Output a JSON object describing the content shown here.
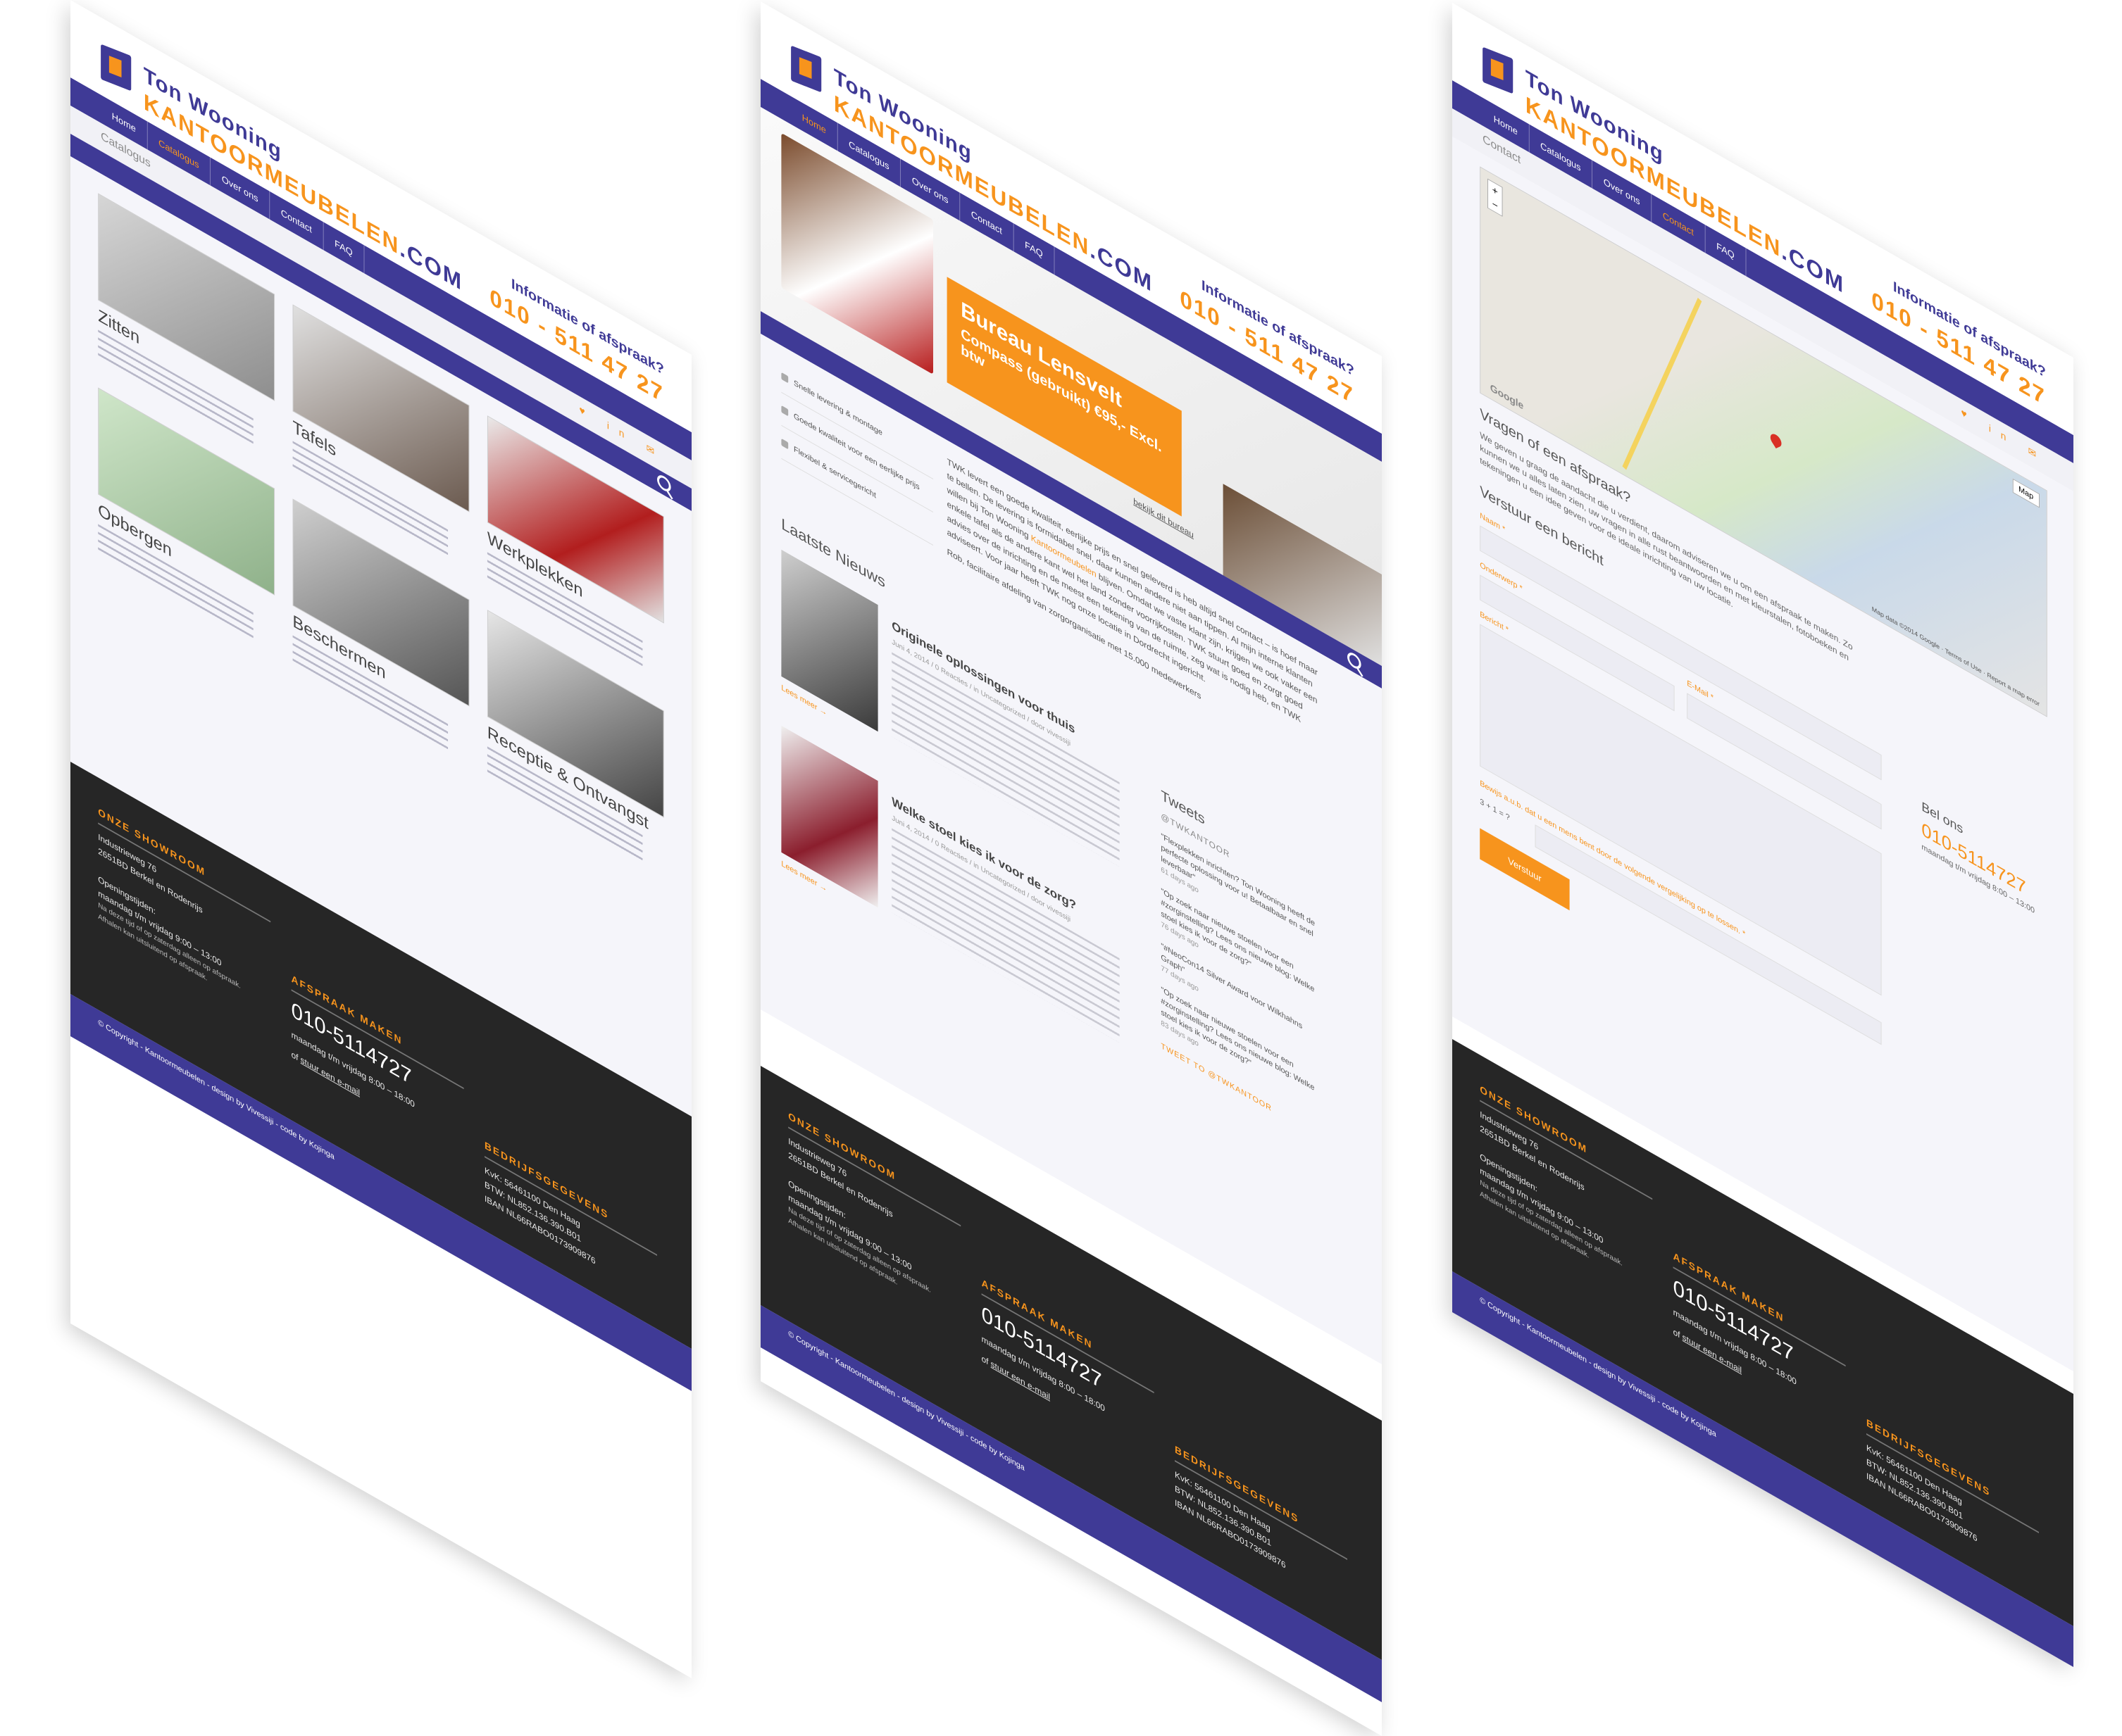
{
  "brand": {
    "name": "Ton Wooning",
    "domain_main": "KANTOORMEUBELEN",
    "domain_ext": ".COM",
    "info_label": "Informatie of afspraak?",
    "info_phone": "010 - 511 47 27"
  },
  "nav": [
    "Home",
    "Catalogus",
    "Over ons",
    "Contact",
    "FAQ"
  ],
  "social": "♥ in ✉",
  "pages": {
    "catalog": {
      "breadcrumb": "Catalogus",
      "categories": [
        "Zitten",
        "Tafels",
        "Werkplekken",
        "Opbergen",
        "Beschermen",
        "Receptie & Ontvangst"
      ]
    },
    "home": {
      "hero_title": "Bureau Lensvelt",
      "hero_sub": "Compass (gebruikt) €95,- Excl. btw",
      "hero_link": "bekijk dit bureau",
      "usps": [
        "Snelle levering & montage",
        "Goede kwaliteit voor een eerlijke prijs",
        "Flexibel & servicegericht"
      ],
      "intro_a": "TWK levert een goede kwaliteit, eerlijke prijs en snel geleverd is heb altijd snel contact – is hoef maar te bellen. De levering is formidabel snel, daar kunnen andere niet aan tippen. Al mijn interne klanten willen bij Ton Wooning ",
      "intro_hl": "Kantoormeubelen",
      "intro_b": " blijven. Omdat we vaste klant zijn, krijgen we ook vaker een enkele tafel als de andere kant wel het land zonder voorrijkosten. TWK stuurt goed en zorgt goed advies over de inrichting en de meest een tekening van de ruimte, zeg wat is nodig heb, en TWK adviseert. Voor jaar heeft TWK nog onze locatie in Dordrecht ingericht.",
      "intro_sig": "Rob, facilitaire afdeling van zorgorganisatie met 15.000 medewerkers",
      "news_heading": "Laatste Nieuws",
      "news": [
        {
          "title": "Originele oplossingen voor thuis",
          "meta": "Juni 4, 2014 / 0 Reacties / in Uncategorized / door vivessiji",
          "more": "Lees meer →"
        },
        {
          "title": "Welke stoel kies ik voor de zorg?",
          "meta": "Juni 4, 2014 / 0 Reacties / in Uncategorized / door vivessiji",
          "more": "Lees meer →"
        }
      ],
      "tweets_heading": "Tweets",
      "tweets_handle": "@TWKANTOOR",
      "tweets": [
        {
          "text": "\"Flexplekken inrichten? Ton Wooning heeft de perfecte oplossing voor u! Betaalbaar en snel leverbaar\"",
          "date": "61 days ago"
        },
        {
          "text": "\"Op zoek naar nieuwe stoelen voor een #zorginstelling? Lees ons nieuwe blog: Welke stoel kies ik voor de zorg?\"",
          "date": "76 days ago"
        },
        {
          "text": "\"#NeoCon14 Silver Award voor Wilkhahns Graph\"",
          "date": "77 days ago"
        },
        {
          "text": "\"Op zoek naar nieuwe stoelen voor een #zorginstelling? Lees ons nieuwe blog: Welke stoel kies ik voor de zorg?\"",
          "date": "83 days ago"
        }
      ],
      "tweet_to": "TWEET TO @TWKANTOOR"
    },
    "contact": {
      "breadcrumb": "Contact",
      "map_type": "Map",
      "map_brand": "Google",
      "map_data": "Map data ©2014 Google · Terms of Use · Report a map error",
      "heading1": "Vragen of een afspraak?",
      "para": "We geven u graag de aandacht die u verdient, daarom adviseren we u om een afspraak te maken. Zo kunnen we u alles laten zien, uw vragen in alle rust beantwoorden en met kleurstalen, fotoboeken en tekeningen u een idee geven voor de ideale inrichting van uw locatie.",
      "heading2": "Verstuur een bericht",
      "label_name": "Naam",
      "label_subject": "Onderwerp",
      "label_email": "E-Mail",
      "label_message": "Bericht",
      "captcha_label": "Bewijs a.u.b. dat u een mens bent door de volgende vergelijking op te lossen.",
      "captcha_q": "3 + 1 = ?",
      "send": "Verstuur",
      "call_heading": "Bel ons",
      "call_number": "010-5114727",
      "call_hours": "maandag t/m vrijdag 8:00 – 13:00"
    }
  },
  "footer": {
    "showroom_h": "ONZE SHOWROOM",
    "address1": "Industrieweg 76",
    "address2": "2651BD Berkel en Rodenrijs",
    "hours_label": "Openingstijden:",
    "hours": "maandag t/m vrijdag 9:00 – 13:00",
    "hours_note": "Na deze tijd of op zaterdag alleen op afspraak.",
    "hours_note2": "Afhalen kan uitsluitend op afspraak.",
    "appt_h": "AFSPRAAK MAKEN",
    "appt_phone": "010-5114727",
    "appt_hours": "maandag t/m vrijdag 8:00 – 18:00",
    "appt_or": "of ",
    "appt_mail": "stuur een e-mail",
    "company_h": "BEDRIJFSGEGEVENS",
    "kvk": "KvK: 56461100 Den Haag",
    "btw": "BTW: NL852.136.390.B01",
    "iban": "IBAN NL66RABO0173909876",
    "copyright": "© Copyright - Kantoormeubelen - design by Vivessiji - code by Kojinga"
  }
}
